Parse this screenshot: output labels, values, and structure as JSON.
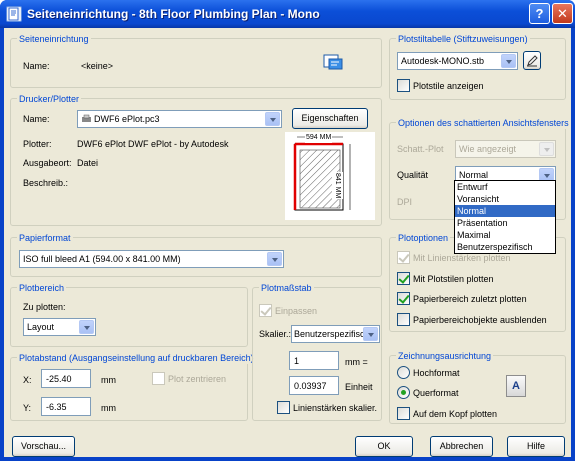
{
  "window": {
    "title": "Seiteneinrichtung - 8th Floor Plumbing Plan - Mono",
    "help_label": "?",
    "close_label": "✕",
    "accent": "#0a48cf"
  },
  "seiteneinrichtung": {
    "group_title": "Seiteneinrichtung",
    "name_label": "Name:",
    "name_value": "<keine>",
    "icon": "page-setup-icon"
  },
  "drucker": {
    "group_title": "Drucker/Plotter",
    "name_label": "Name:",
    "name_value": "DWF6 ePlot.pc3",
    "properties_label": "Eigenschaften",
    "plotter_label": "Plotter:",
    "plotter_value": "DWF6 ePlot DWF ePlot - by Autodesk",
    "output_label": "Ausgabeort:",
    "output_value": "Datei",
    "desc_label": "Beschreib.:",
    "preview_width": "594 MM",
    "preview_height": "841 MM"
  },
  "papierformat": {
    "group_title": "Papierformat",
    "value": "ISO full bleed A1 (594.00 x 841.00 MM)"
  },
  "plotbereich": {
    "group_title": "Plotbereich",
    "label": "Zu plotten:",
    "value": "Layout"
  },
  "plotabstand": {
    "group_title": "Plotabstand (Ausgangseinstellung auf druckbaren Bereich)",
    "x_label": "X:",
    "x_value": "-25.40",
    "x_unit": "mm",
    "y_label": "Y:",
    "y_value": "-6.35",
    "y_unit": "mm",
    "center_label": "Plot zentrieren"
  },
  "plotmassstab": {
    "group_title": "Plotmaßstab",
    "fit_label": "Einpassen",
    "scale_label": "Skalier.:",
    "scale_value": "Benutzerspezifisch",
    "value1": "1",
    "unit1": "mm =",
    "value2": "0.03937",
    "unit2": "Einheit",
    "lineweight_label": "Linienstärken skalier."
  },
  "plotstil": {
    "group_title": "Plotstiltabelle (Stiftzuweisungen)",
    "value": "Autodesk-MONO.stb",
    "show_label": "Plotstile anzeigen"
  },
  "schattiert": {
    "group_title": "Optionen des schattierten Ansichtsfensters",
    "shade_label": "Schatt.-Plot",
    "shade_value": "Wie angezeigt",
    "quality_label": "Qualität",
    "quality_value": "Normal",
    "dpi_label": "DPI",
    "quality_options": [
      "Entwurf",
      "Voransicht",
      "Normal",
      "Präsentation",
      "Maximal",
      "Benutzerspezifisch"
    ],
    "selected_index": 2
  },
  "plotoptionen": {
    "group_title": "Plotoptionen",
    "opt1": "Mit Linienstärken plotten",
    "opt2": "Mit Plotstilen plotten",
    "opt3": "Papierbereich zuletzt plotten",
    "opt4": "Papierbereichobjekte ausblenden"
  },
  "ausrichtung": {
    "group_title": "Zeichnungsausrichtung",
    "portrait": "Hochformat",
    "landscape": "Querformat",
    "upside_down": "Auf dem Kopf plotten",
    "orientation_glyph": "A"
  },
  "footer": {
    "preview": "Vorschau...",
    "ok": "OK",
    "cancel": "Abbrechen",
    "help": "Hilfe"
  }
}
